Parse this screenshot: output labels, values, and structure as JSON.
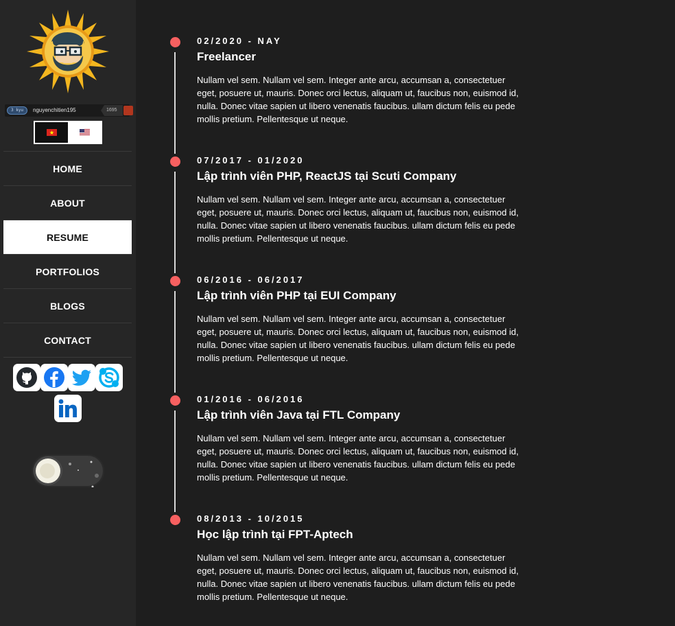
{
  "sidebar": {
    "codewars": {
      "rank": "3 kyu",
      "username": "nguyenchitien195",
      "honor": "1695"
    },
    "languages": [
      {
        "code": "vi",
        "icon": "vietnam-flag-icon"
      },
      {
        "code": "en",
        "icon": "us-flag-icon"
      }
    ],
    "nav": [
      {
        "label": "HOME"
      },
      {
        "label": "ABOUT"
      },
      {
        "label": "RESUME",
        "active": true
      },
      {
        "label": "PORTFOLIOS"
      },
      {
        "label": "BLOGS"
      },
      {
        "label": "CONTACT"
      }
    ],
    "social": [
      "github-icon",
      "facebook-icon",
      "twitter-icon",
      "skype-icon",
      "linkedin-icon"
    ],
    "theme_toggle": {
      "state": "dark",
      "icon": "moon-icon"
    }
  },
  "resume": {
    "entries": [
      {
        "date": "02/2020 - NAY",
        "title": "Freelancer",
        "description": "Nullam vel sem. Nullam vel sem. Integer ante arcu, accumsan a, consectetuer eget, posuere ut, mauris. Donec orci lectus, aliquam ut, faucibus non, euismod id, nulla. Donec vitae sapien ut libero venenatis faucibus. ullam dictum felis eu pede mollis pretium. Pellentesque ut neque."
      },
      {
        "date": "07/2017 - 01/2020",
        "title": "Lập trình viên PHP, ReactJS tại Scuti Company",
        "description": "Nullam vel sem. Nullam vel sem. Integer ante arcu, accumsan a, consectetuer eget, posuere ut, mauris. Donec orci lectus, aliquam ut, faucibus non, euismod id, nulla. Donec vitae sapien ut libero venenatis faucibus. ullam dictum felis eu pede mollis pretium. Pellentesque ut neque."
      },
      {
        "date": "06/2016 - 06/2017",
        "title": "Lập trình viên PHP tại EUI Company",
        "description": "Nullam vel sem. Nullam vel sem. Integer ante arcu, accumsan a, consectetuer eget, posuere ut, mauris. Donec orci lectus, aliquam ut, faucibus non, euismod id, nulla. Donec vitae sapien ut libero venenatis faucibus. ullam dictum felis eu pede mollis pretium. Pellentesque ut neque."
      },
      {
        "date": "01/2016 - 06/2016",
        "title": "Lập trình viên Java tại FTL Company",
        "description": "Nullam vel sem. Nullam vel sem. Integer ante arcu, accumsan a, consectetuer eget, posuere ut, mauris. Donec orci lectus, aliquam ut, faucibus non, euismod id, nulla. Donec vitae sapien ut libero venenatis faucibus. ullam dictum felis eu pede mollis pretium. Pellentesque ut neque."
      },
      {
        "date": "08/2013 - 10/2015",
        "title": "Học lập trình tại FPT-Aptech",
        "description": "Nullam vel sem. Nullam vel sem. Integer ante arcu, accumsan a, consectetuer eget, posuere ut, mauris. Donec orci lectus, aliquam ut, faucibus non, euismod id, nulla. Donec vitae sapien ut libero venenatis faucibus. ullam dictum felis eu pede mollis pretium. Pellentesque ut neque."
      }
    ]
  },
  "colors": {
    "background": "#1e1e1e",
    "sidebar": "#262626",
    "accent_dot": "#f76060",
    "timeline_line": "#d9d9d9"
  }
}
